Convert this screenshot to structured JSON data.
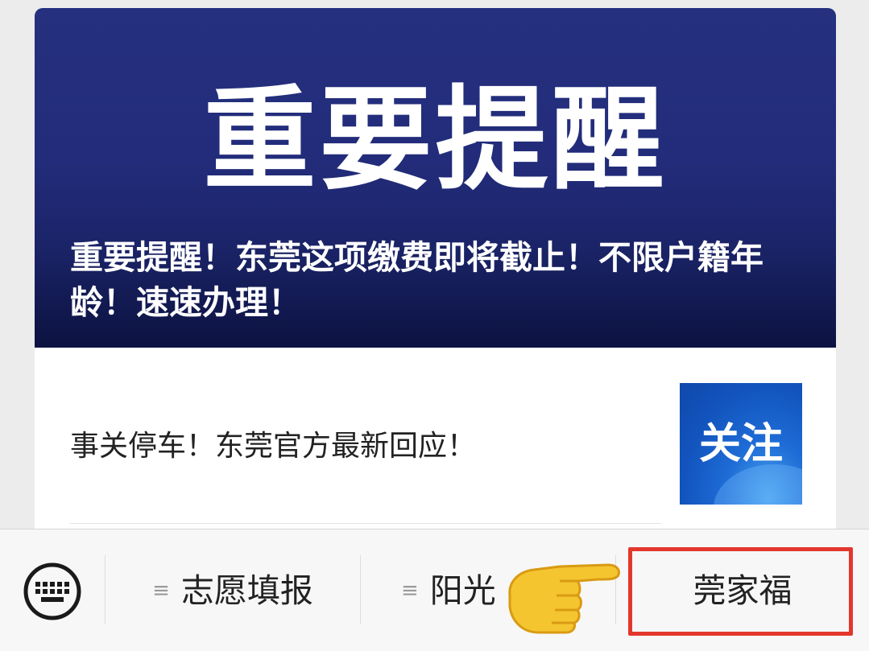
{
  "article": {
    "cover_big_text": "重要提醒",
    "cover_headline": "重要提醒！东莞这项缴费即将截止！不限户籍年龄！速速办理！",
    "secondary_title": "事关停车！东莞官方最新回应！",
    "thumb_text": "关注"
  },
  "menu": {
    "items": [
      {
        "lines": "≡",
        "label": "志愿填报"
      },
      {
        "lines": "≡",
        "label": "阳光"
      },
      {
        "label": "莞家福"
      }
    ]
  },
  "colors": {
    "cover_bg": "#222c7a",
    "thumb_bg": "#1253bd",
    "highlight_border": "#e3372d",
    "menubar_bg": "#f7f7f7"
  },
  "icons": {
    "keyboard": "keyboard-icon",
    "menu_lines": "menu-lines-icon",
    "pointing_hand": "pointing-hand-icon"
  }
}
